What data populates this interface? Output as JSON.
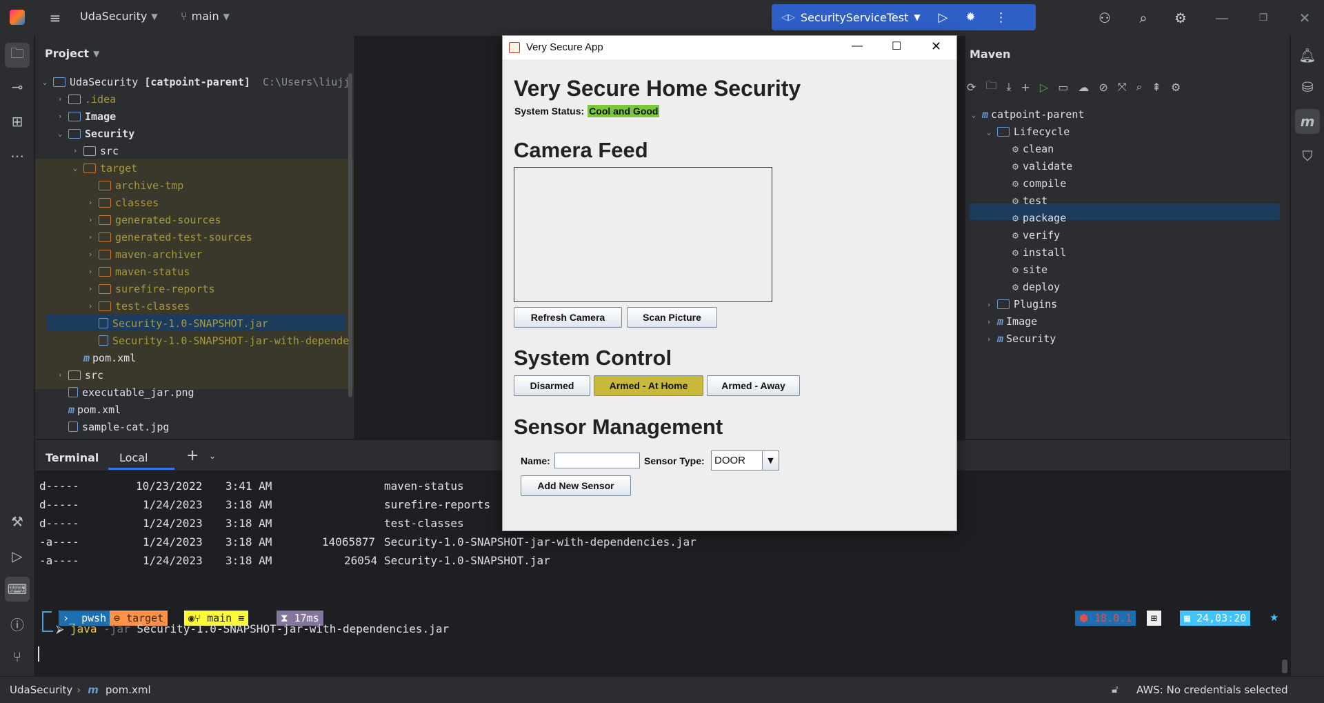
{
  "titlebar": {
    "project_name": "UdaSecurity",
    "branch": "main",
    "run_config": "SecurityServiceTest"
  },
  "project_panel": {
    "title": "Project",
    "root_name": "UdaSecurity",
    "root_module": "[catpoint-parent]",
    "root_path": "C:\\Users\\liujj",
    "items": {
      "idea": ".idea",
      "image": "Image",
      "security": "Security",
      "src": "src",
      "target": "target",
      "archive_tmp": "archive-tmp",
      "classes": "classes",
      "generated_sources": "generated-sources",
      "generated_test_sources": "generated-test-sources",
      "maven_archiver": "maven-archiver",
      "maven_status": "maven-status",
      "surefire_reports": "surefire-reports",
      "test_classes": "test-classes",
      "jar": "Security-1.0-SNAPSHOT.jar",
      "jar_deps": "Security-1.0-SNAPSHOT-jar-with-depende",
      "pom_security": "pom.xml",
      "src_root": "src",
      "executable_png": "executable_jar.png",
      "pom_root": "pom.xml",
      "sample_cat": "sample-cat.jpg"
    }
  },
  "maven_panel": {
    "title": "Maven",
    "root": "catpoint-parent",
    "lifecycle": "Lifecycle",
    "goals": [
      "clean",
      "validate",
      "compile",
      "test",
      "package",
      "verify",
      "install",
      "site",
      "deploy"
    ],
    "plugins": "Plugins",
    "image_module": "Image",
    "security_module": "Security"
  },
  "swing_app": {
    "window_title": "Very Secure App",
    "heading": "Very Secure Home Security",
    "status_label": "System Status:",
    "status_value": "Cool and Good",
    "status_color": "#7ac73b",
    "camera_heading": "Camera Feed",
    "refresh_button": "Refresh Camera",
    "scan_button": "Scan Picture",
    "control_heading": "System Control",
    "disarmed_button": "Disarmed",
    "armed_home_button": "Armed - At Home",
    "armed_away_button": "Armed - Away",
    "active_color": "#c8b93a",
    "sensor_heading": "Sensor Management",
    "name_label": "Name:",
    "name_value": "",
    "sensor_type_label": "Sensor Type:",
    "sensor_type_value": "DOOR",
    "add_sensor_button": "Add New Sensor"
  },
  "terminal": {
    "tab_terminal": "Terminal",
    "tab_local": "Local",
    "lines": [
      {
        "mode": "d-----",
        "date": "10/23/2022",
        "time": "3:41 AM",
        "size": "",
        "name": "maven-status"
      },
      {
        "mode": "d-----",
        "date": "1/24/2023",
        "time": "3:18 AM",
        "size": "",
        "name": "surefire-reports"
      },
      {
        "mode": "d-----",
        "date": "1/24/2023",
        "time": "3:18 AM",
        "size": "",
        "name": "test-classes"
      },
      {
        "mode": "-a----",
        "date": "1/24/2023",
        "time": "3:18 AM",
        "size": "14065877",
        "name": "Security-1.0-SNAPSHOT-jar-with-dependencies.jar"
      },
      {
        "mode": "-a----",
        "date": "1/24/2023",
        "time": "3:18 AM",
        "size": "26054",
        "name": "Security-1.0-SNAPSHOT.jar"
      }
    ],
    "prompt": {
      "shell": "pwsh",
      "dir": "target",
      "branch": "main ≡",
      "duration": "17ms",
      "node": "18.0.1",
      "clock": "24,03:20"
    },
    "command": {
      "exe": "java",
      "flag": "-jar",
      "arg": "Security-1.0-SNAPSHOT-jar-with-dependencies.jar"
    }
  },
  "statusbar": {
    "crumb_project": "UdaSecurity",
    "crumb_file": "pom.xml",
    "aws": "AWS: No credentials selected"
  }
}
